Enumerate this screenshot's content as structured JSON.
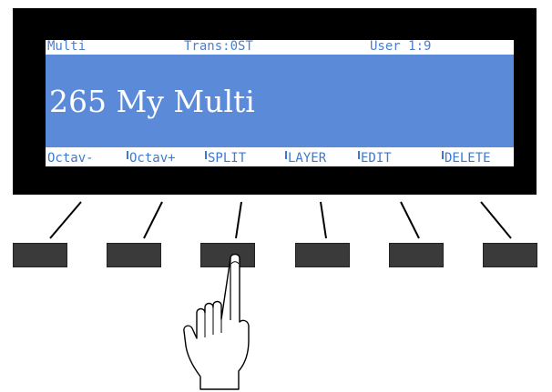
{
  "display": {
    "mode_label": "Multi",
    "transpose_label": "Trans:0ST",
    "bank_label": "User 1:9",
    "program_name": "265 My Multi"
  },
  "soft_buttons": [
    {
      "label": "Octav-"
    },
    {
      "label": "Octav+"
    },
    {
      "label": "SPLIT"
    },
    {
      "label": "LAYER"
    },
    {
      "label": "EDIT"
    },
    {
      "label": "DELETE"
    }
  ],
  "colors": {
    "bezel": "#000000",
    "lcd_highlight": "#5b8ad8",
    "lcd_text": "#4a7fcf",
    "button": "#3a3a3a"
  },
  "pressed_button": "SPLIT",
  "icons": {
    "pointer": "pointing-hand-icon"
  }
}
